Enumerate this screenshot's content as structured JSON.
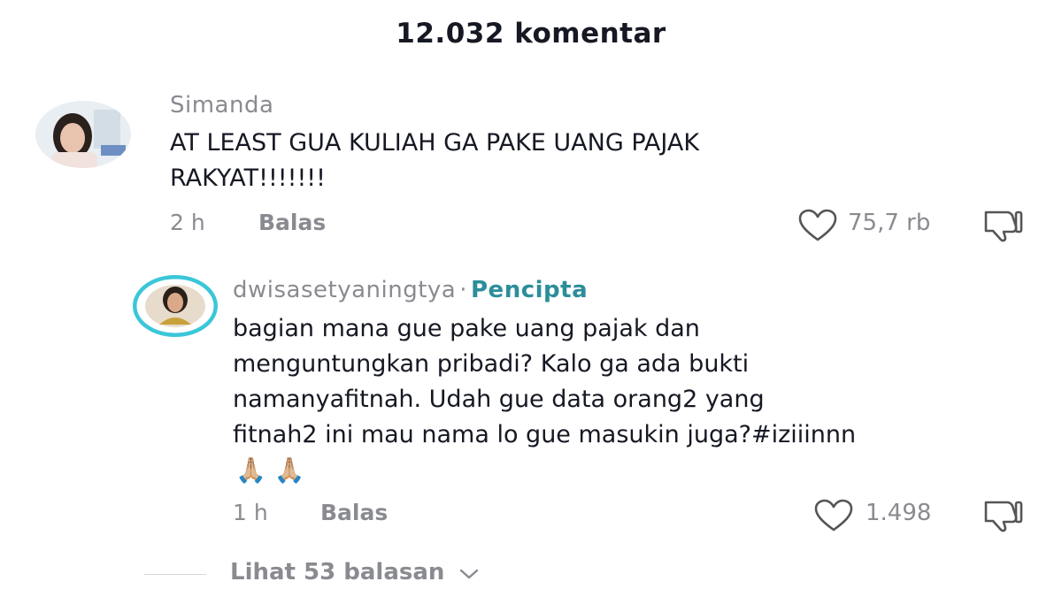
{
  "header": {
    "title": "12.032 komentar"
  },
  "comments": [
    {
      "username": "Simanda",
      "text": "AT LEAST GUA KULIAH GA PAKE UANG PAJAK\nRAKYAT!!!!!!!",
      "time": "2 h",
      "reply_label": "Balas",
      "likes": "75,7 rb",
      "icons": {
        "like": "heart-outline-icon",
        "dislike": "thumbs-down-icon"
      }
    }
  ],
  "reply": {
    "username": "dwisasetyaningtya",
    "separator": "·",
    "badge": "Pencipta",
    "text": "bagian mana gue pake uang pajak dan\nmenguntungkan pribadi? Kalo ga ada bukti\nnamanyafitnah. Udah gue data orang2 yang\nfitnah2 ini mau nama lo gue masukin juga?#iziiinnn",
    "emoji": "🙏🏼 🙏🏼",
    "time": "1 h",
    "reply_label": "Balas",
    "likes": "1.498",
    "icons": {
      "like": "heart-outline-icon",
      "dislike": "thumbs-down-icon"
    }
  },
  "view_replies": {
    "label": "Lihat 53 balasan"
  },
  "colors": {
    "creator_badge": "#2b8e9a",
    "muted": "#8a8b91",
    "text": "#161823",
    "avatar_ring": "#3bc6d9"
  }
}
